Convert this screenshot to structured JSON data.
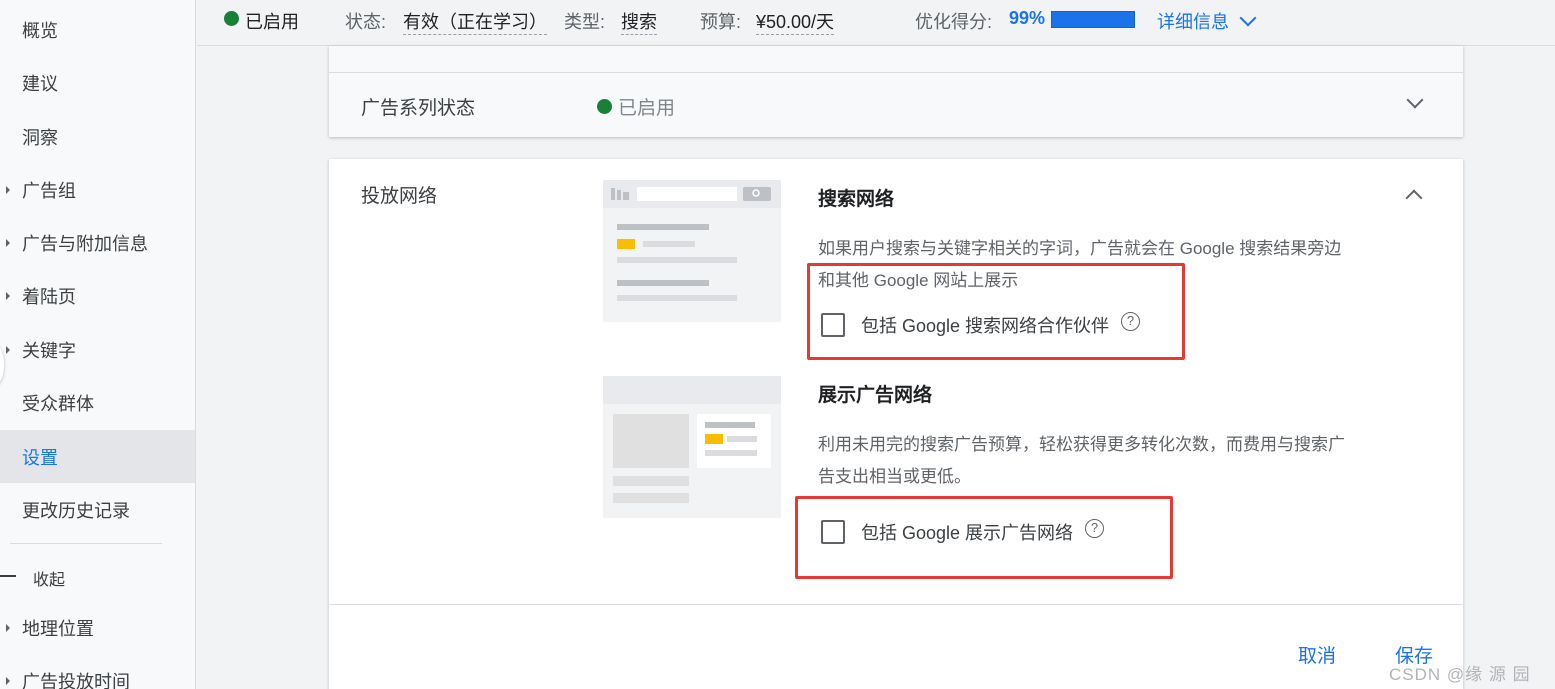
{
  "sidebar": {
    "items": [
      {
        "label": "概览",
        "caret": false,
        "active": false
      },
      {
        "label": "建议",
        "caret": false,
        "active": false
      },
      {
        "label": "洞察",
        "caret": false,
        "active": false
      },
      {
        "label": "广告组",
        "caret": true,
        "active": false
      },
      {
        "label": "广告与附加信息",
        "caret": true,
        "active": false
      },
      {
        "label": "着陆页",
        "caret": true,
        "active": false
      },
      {
        "label": "关键字",
        "caret": true,
        "active": false
      },
      {
        "label": "受众群体",
        "caret": false,
        "active": false
      },
      {
        "label": "设置",
        "caret": false,
        "active": true
      },
      {
        "label": "更改历史记录",
        "caret": false,
        "active": false
      }
    ],
    "collapse_label": "收起",
    "more_items": [
      {
        "label": "地理位置",
        "caret": true
      },
      {
        "label": "广告投放时间",
        "caret": true
      }
    ]
  },
  "topbar": {
    "enabled_label": "已启用",
    "status_key": "状态:",
    "status_value": "有效（正在学习）",
    "type_key": "类型:",
    "type_value": "搜索",
    "budget_key": "预算:",
    "budget_value": "¥50.00/天",
    "score_key": "优化得分:",
    "score_value": "99%",
    "score_fraction": 0.99,
    "details_link": "详细信息"
  },
  "status_card": {
    "label": "广告系列状态",
    "status": "已启用"
  },
  "networks_card": {
    "label": "投放网络",
    "search": {
      "title": "搜索网络",
      "description": "如果用户搜索与关键字相关的字词，广告就会在 Google 搜索结果旁边和其他 Google 网站上展示",
      "checkbox_label": "包括 Google 搜索网络合作伙伴",
      "checked": false
    },
    "display": {
      "title": "展示广告网络",
      "description": "利用未用完的搜索广告预算，轻松获得更多转化次数，而费用与搜索广告支出相当或更低。",
      "checkbox_label": "包括 Google 展示广告网络",
      "checked": false
    },
    "help_glyph": "?",
    "cancel_label": "取消",
    "save_label": "保存"
  },
  "watermark": "CSDN @缘 源 园",
  "colors": {
    "accent": "#1a73e8",
    "enabled": "#188038",
    "highlight": "#e53935",
    "ad_yellow": "#fbbc04"
  }
}
